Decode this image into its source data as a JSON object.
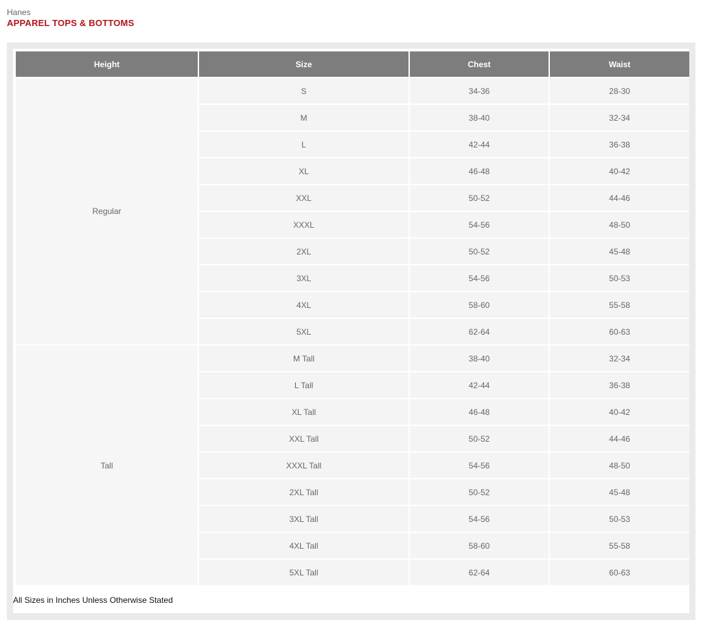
{
  "brand": "Hanes",
  "title": "APPAREL TOPS & BOTTOMS",
  "table": {
    "headers": [
      "Height",
      "Size",
      "Chest",
      "Waist"
    ],
    "groups": [
      {
        "height": "Regular",
        "rows": [
          [
            "S",
            "34-36",
            "28-30"
          ],
          [
            "M",
            "38-40",
            "32-34"
          ],
          [
            "L",
            "42-44",
            "36-38"
          ],
          [
            "XL",
            "46-48",
            "40-42"
          ],
          [
            "XXL",
            "50-52",
            "44-46"
          ],
          [
            "XXXL",
            "54-56",
            "48-50"
          ],
          [
            "2XL",
            "50-52",
            "45-48"
          ],
          [
            "3XL",
            "54-56",
            "50-53"
          ],
          [
            "4XL",
            "58-60",
            "55-58"
          ],
          [
            "5XL",
            "62-64",
            "60-63"
          ]
        ]
      },
      {
        "height": "Tall",
        "rows": [
          [
            "M Tall",
            "38-40",
            "32-34"
          ],
          [
            "L Tall",
            "42-44",
            "36-38"
          ],
          [
            "XL Tall",
            "46-48",
            "40-42"
          ],
          [
            "XXL Tall",
            "50-52",
            "44-46"
          ],
          [
            "XXXL Tall",
            "54-56",
            "48-50"
          ],
          [
            "2XL Tall",
            "50-52",
            "45-48"
          ],
          [
            "3XL Tall",
            "54-56",
            "50-53"
          ],
          [
            "4XL Tall",
            "58-60",
            "55-58"
          ],
          [
            "5XL Tall",
            "62-64",
            "60-63"
          ]
        ]
      }
    ]
  },
  "footnote": "All Sizes in Inches Unless Otherwise Stated"
}
